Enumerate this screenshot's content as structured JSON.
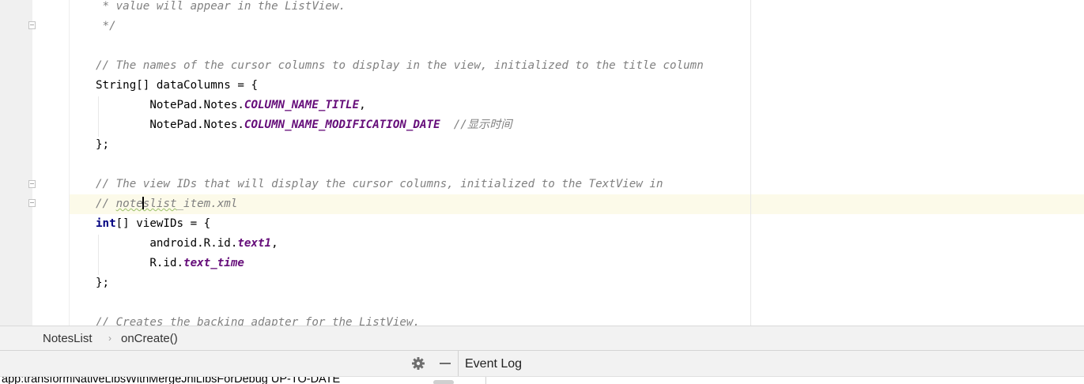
{
  "editor": {
    "lines": [
      {
        "name": "javadoc-line-1",
        "segments": [
          {
            "text": " * value will appear in the ListView.",
            "cls": "comment"
          }
        ]
      },
      {
        "name": "javadoc-close",
        "segments": [
          {
            "text": " */",
            "cls": "comment"
          }
        ]
      },
      {
        "name": "comment-data-columns",
        "segments": [
          {
            "text": "// The names of the cursor columns to display in the view, initialized to the title column",
            "cls": "comment"
          }
        ]
      },
      {
        "name": "data-columns-decl",
        "segments": [
          {
            "text": "String[] dataColumns = {",
            "cls": "plain"
          }
        ]
      },
      {
        "name": "column-title-entry",
        "segments": [
          {
            "text": "        NotePad.Notes.",
            "cls": "plain"
          },
          {
            "text": "COLUMN_NAME_TITLE",
            "cls": "field"
          },
          {
            "text": ",",
            "cls": "plain"
          }
        ]
      },
      {
        "name": "column-date-entry",
        "segments": [
          {
            "text": "        NotePad.Notes.",
            "cls": "plain"
          },
          {
            "text": "COLUMN_NAME_MODIFICATION_DATE",
            "cls": "field"
          },
          {
            "text": "  ",
            "cls": "plain"
          },
          {
            "text": "//显示时间",
            "cls": "comment"
          }
        ]
      },
      {
        "name": "data-columns-close",
        "segments": [
          {
            "text": "};",
            "cls": "plain"
          }
        ]
      },
      {
        "name": "comment-view-ids",
        "segments": [
          {
            "text": "// The view IDs that will display the cursor columns, initialized to the TextView in",
            "cls": "comment"
          }
        ]
      },
      {
        "name": "comment-xml-file",
        "segments": [
          {
            "text": "// ",
            "cls": "comment"
          },
          {
            "text": "note",
            "cls": "comment typo"
          },
          {
            "caret": true
          },
          {
            "text": "slist",
            "cls": "comment typo"
          },
          {
            "text": "_item.xml",
            "cls": "comment"
          }
        ]
      },
      {
        "name": "view-ids-decl",
        "segments": [
          {
            "text": "int",
            "cls": "kw"
          },
          {
            "text": "[] viewIDs = {",
            "cls": "plain"
          }
        ]
      },
      {
        "name": "view-id-text1",
        "segments": [
          {
            "text": "        android.R.id.",
            "cls": "plain"
          },
          {
            "text": "text1",
            "cls": "field"
          },
          {
            "text": ",",
            "cls": "plain"
          }
        ]
      },
      {
        "name": "view-id-text-time",
        "segments": [
          {
            "text": "        R.id.",
            "cls": "plain"
          },
          {
            "text": "text_time",
            "cls": "field"
          }
        ]
      },
      {
        "name": "view-ids-close",
        "segments": [
          {
            "text": "};",
            "cls": "plain"
          }
        ]
      },
      {
        "name": "comment-adapter",
        "segments": [
          {
            "text": "// Creates the backing adapter for the ListView.",
            "cls": "comment"
          }
        ]
      }
    ]
  },
  "breadcrumb": {
    "class_name": "NotesList",
    "separator": "›",
    "method_name": "onCreate()"
  },
  "tool_window": {
    "gear_icon": "gear-icon",
    "minimize_icon": "minimize-icon",
    "event_log_title": "Event Log"
  },
  "build_output": {
    "text": "app:transformNativeLibsWithMergeJniLibsForDebug UP-TO-DATE"
  }
}
